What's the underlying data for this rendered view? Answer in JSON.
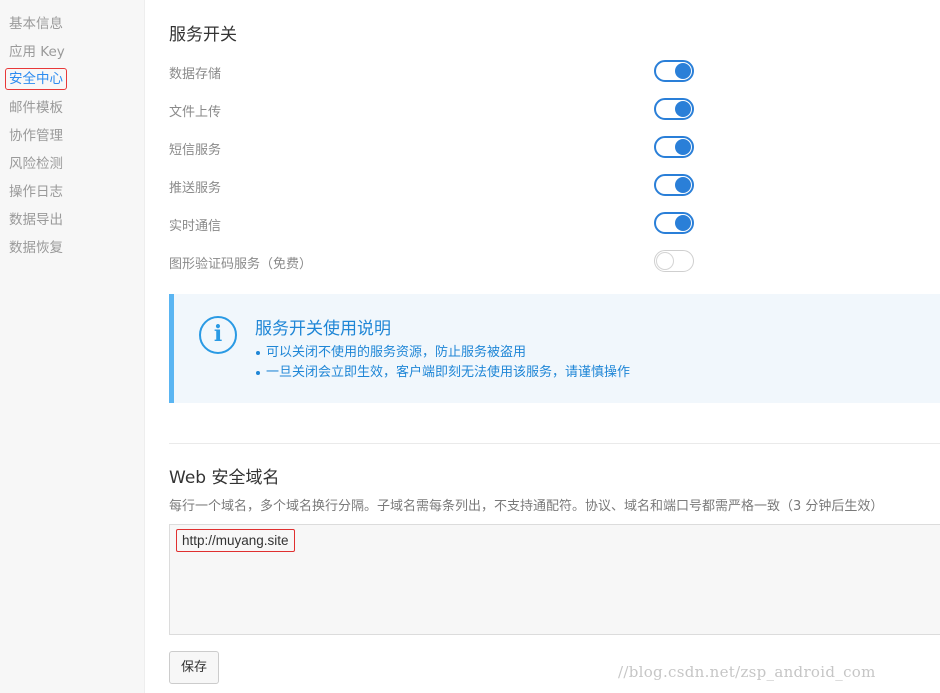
{
  "sidebar": {
    "items": [
      {
        "label": "基本信息"
      },
      {
        "label": "应用 Key"
      },
      {
        "label": "安全中心",
        "active": true
      },
      {
        "label": "邮件模板"
      },
      {
        "label": "协作管理"
      },
      {
        "label": "风险检测"
      },
      {
        "label": "操作日志"
      },
      {
        "label": "数据导出"
      },
      {
        "label": "数据恢复"
      }
    ]
  },
  "services": {
    "title": "服务开关",
    "items": [
      {
        "label": "数据存储",
        "enabled": true
      },
      {
        "label": "文件上传",
        "enabled": true
      },
      {
        "label": "短信服务",
        "enabled": true
      },
      {
        "label": "推送服务",
        "enabled": true
      },
      {
        "label": "实时通信",
        "enabled": true
      },
      {
        "label": "图形验证码服务（免费）",
        "enabled": false
      }
    ]
  },
  "notice": {
    "icon": "info-icon",
    "icon_glyph": "i",
    "title": "服务开关使用说明",
    "items": [
      "可以关闭不使用的服务资源，防止服务被盗用",
      "一旦关闭会立即生效，客户端即刻无法使用该服务，请谨慎操作"
    ]
  },
  "web_domain": {
    "title": "Web 安全域名",
    "hint": "每行一个域名，多个域名换行分隔。子域名需每条列出，不支持通配符。协议、域名和端口号都需严格一致（3 分钟后生效）",
    "value": "http://muyang.site",
    "save_label": "保存"
  },
  "watermark": "//blog.csdn.net/zsp_android_com",
  "colors": {
    "accent": "#2a7fd8",
    "info_text": "#1f86d6",
    "info_bg": "#f1f7fc",
    "info_border": "#5ab5f2",
    "highlight_border": "#e03030"
  }
}
